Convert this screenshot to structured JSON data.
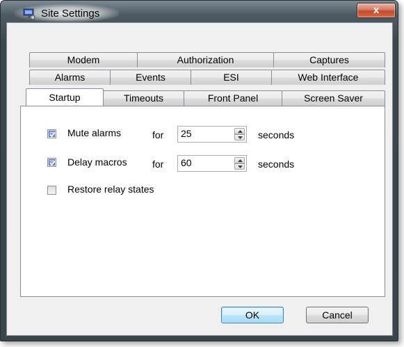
{
  "window": {
    "title": "Site Settings",
    "close_glyph": "x"
  },
  "tabs": {
    "row1": [
      {
        "label": "Modem"
      },
      {
        "label": "Authorization"
      },
      {
        "label": "Captures"
      }
    ],
    "row2": [
      {
        "label": "Alarms"
      },
      {
        "label": "Events"
      },
      {
        "label": "ESI"
      },
      {
        "label": "Web Interface"
      }
    ],
    "row3": [
      {
        "label": "Startup"
      },
      {
        "label": "Timeouts"
      },
      {
        "label": "Front Panel"
      },
      {
        "label": "Screen Saver"
      }
    ],
    "selected": "Startup"
  },
  "startup": {
    "mute_alarms": {
      "label": "Mute alarms",
      "checked": true,
      "for_label": "for",
      "value": "25",
      "unit": "seconds"
    },
    "delay_macros": {
      "label": "Delay macros",
      "checked": true,
      "for_label": "for",
      "value": "60",
      "unit": "seconds"
    },
    "restore_relay": {
      "label": "Restore relay states",
      "checked": false
    }
  },
  "buttons": {
    "ok": "OK",
    "cancel": "Cancel"
  },
  "icons": {
    "app": "site-settings-icon",
    "close": "close-icon",
    "spin_up": "chevron-up-icon",
    "spin_down": "chevron-down-icon",
    "check": "checkmark-icon"
  },
  "colors": {
    "close_button": "#c04a2e",
    "check_fill": "#6a86d8",
    "default_button_border": "#3c7fb1"
  }
}
